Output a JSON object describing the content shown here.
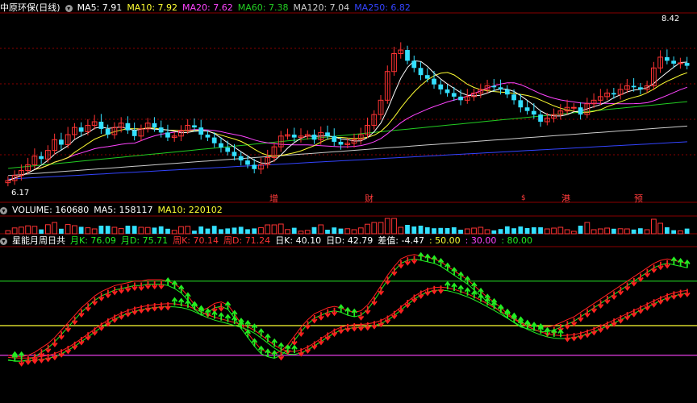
{
  "colors": {
    "up": "#ff3333",
    "down": "#33e0ff",
    "ma5": "#ffffff",
    "ma10": "#ffff33",
    "ma20": "#ff44ff",
    "ma60": "#22cc22",
    "ma120": "#cccccc",
    "ma250": "#3344ff",
    "grid": "#8a0000",
    "kd_up": "#ff2020",
    "kd_down": "#22ee22"
  },
  "price_header": {
    "title": "中原环保(日线)",
    "ma": [
      {
        "label": "MA5: 7.91",
        "color": "#ffffff"
      },
      {
        "label": "MA10: 7.92",
        "color": "#ffff33"
      },
      {
        "label": "MA20: 7.62",
        "color": "#ff44ff"
      },
      {
        "label": "MA60: 7.38",
        "color": "#22cc22"
      },
      {
        "label": "MA120: 7.04",
        "color": "#cccccc"
      },
      {
        "label": "MA250: 6.82",
        "color": "#3344ff"
      }
    ]
  },
  "volume_header": {
    "items": [
      {
        "label": "VOLUME: 160680",
        "color": "#ffffff"
      },
      {
        "label": "MA5: 158117",
        "color": "#ffffff"
      },
      {
        "label": "MA10: 220102",
        "color": "#ffff33"
      }
    ]
  },
  "indicator_header": {
    "title": "星能月周日共",
    "items": [
      {
        "label": "月K: 76.09",
        "color": "#22ee22"
      },
      {
        "label": "月D: 75.71",
        "color": "#22ee22"
      },
      {
        "label": "周K: 70.14",
        "color": "#ff3333"
      },
      {
        "label": "周D: 71.24",
        "color": "#ff3333"
      },
      {
        "label": "日K: 40.10",
        "color": "#ffffff"
      },
      {
        "label": "日D: 42.79",
        "color": "#ffffff"
      },
      {
        "label": "差值: -4.47",
        "color": "#ffffff"
      },
      {
        "label": ": 50.00",
        "color": "#ffff33"
      },
      {
        "label": ": 30.00",
        "color": "#ff44ff"
      },
      {
        "label": ": 80.00",
        "color": "#22ee22"
      }
    ]
  },
  "price_labels": {
    "high": "8.42",
    "low": "6.17"
  },
  "events": [
    {
      "text": "增",
      "bar": 41
    },
    {
      "text": "财",
      "bar": 56
    },
    {
      "text": "$",
      "bar": 80
    },
    {
      "text": "港",
      "bar": 86
    },
    {
      "text": "预",
      "bar": 97
    }
  ],
  "chart_data": {
    "type": "candlestick",
    "price_range": [
      6.1,
      8.55
    ],
    "close": [
      6.28,
      6.35,
      6.42,
      6.5,
      6.62,
      6.58,
      6.7,
      6.85,
      6.78,
      6.92,
      7.02,
      6.96,
      7.05,
      7.1,
      7.0,
      6.92,
      7.02,
      7.08,
      6.98,
      6.9,
      7.0,
      7.08,
      7.02,
      6.95,
      6.88,
      6.9,
      6.98,
      7.05,
      7.02,
      6.92,
      6.88,
      6.8,
      6.74,
      6.68,
      6.62,
      6.56,
      6.5,
      6.44,
      6.5,
      6.6,
      6.75,
      6.9,
      6.92,
      6.88,
      6.9,
      6.92,
      6.85,
      6.95,
      6.9,
      6.82,
      6.78,
      6.8,
      6.85,
      6.92,
      7.05,
      7.2,
      7.4,
      7.8,
      8.05,
      8.1,
      7.95,
      7.85,
      7.75,
      7.7,
      7.62,
      7.55,
      7.5,
      7.45,
      7.4,
      7.45,
      7.5,
      7.55,
      7.6,
      7.58,
      7.55,
      7.48,
      7.4,
      7.3,
      7.25,
      7.2,
      7.1,
      7.15,
      7.2,
      7.25,
      7.3,
      7.3,
      7.2,
      7.35,
      7.4,
      7.45,
      7.5,
      7.48,
      7.55,
      7.6,
      7.58,
      7.55,
      7.6,
      7.85,
      8.0,
      7.95,
      7.91,
      7.92,
      7.88
    ],
    "ma_lines": {
      "ma60_endpoints": [
        6.45,
        7.38
      ],
      "ma120_endpoints": [
        6.35,
        7.04
      ],
      "ma250_endpoints": [
        6.3,
        6.82
      ]
    },
    "indicator": {
      "range": [
        0,
        100
      ],
      "levels": [
        80,
        50,
        30
      ],
      "week": [
        28,
        27,
        27,
        28,
        30,
        33,
        36,
        40,
        45,
        50,
        55,
        60,
        64,
        68,
        71,
        73,
        75,
        76,
        77,
        78,
        78,
        79,
        79,
        79,
        78,
        76,
        73,
        68,
        62,
        58,
        60,
        63,
        64,
        62,
        56,
        49,
        43,
        37,
        32,
        30,
        29,
        31,
        35,
        41,
        47,
        52,
        56,
        58,
        60,
        61,
        60,
        58,
        57,
        58,
        62,
        68,
        75,
        82,
        88,
        93,
        95,
        96,
        95,
        94,
        93,
        91,
        88,
        85,
        82,
        79,
        75,
        71,
        67,
        64,
        60,
        56,
        53,
        50,
        49,
        48,
        47,
        47,
        48,
        50,
        52,
        54,
        57,
        60,
        63,
        66,
        69,
        72,
        75,
        78,
        81,
        84,
        87,
        90,
        92,
        93,
        92,
        91,
        90
      ]
    }
  }
}
